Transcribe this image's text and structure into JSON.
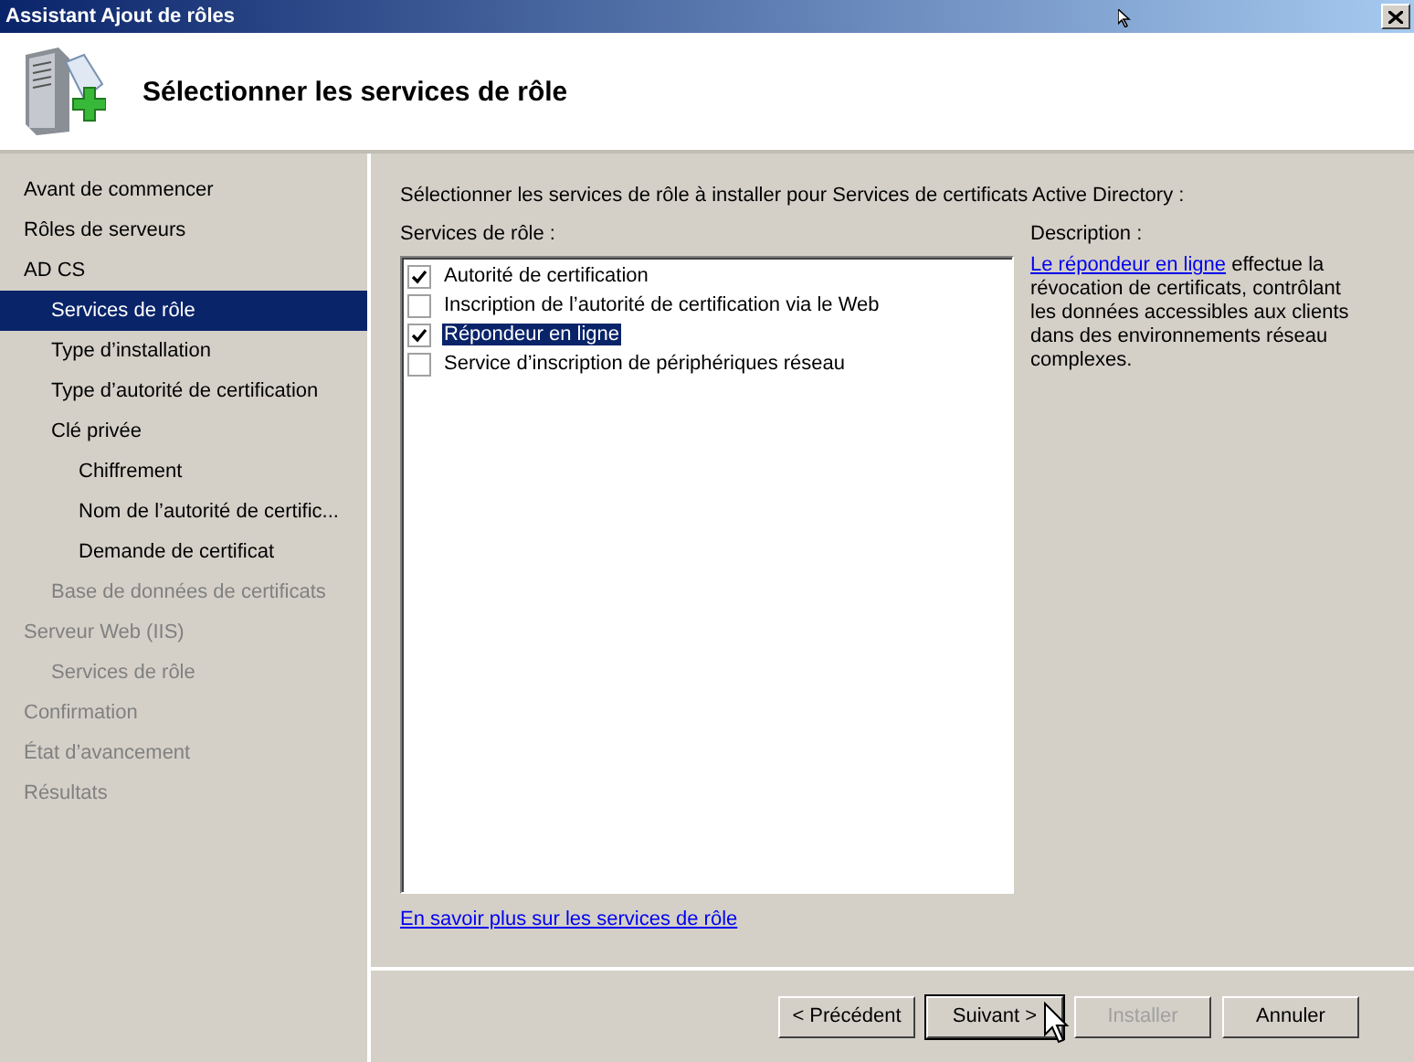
{
  "window": {
    "title": "Assistant Ajout de rôles"
  },
  "header": {
    "title": "Sélectionner les services de rôle"
  },
  "sidebar": {
    "items": [
      {
        "label": "Avant de commencer",
        "selected": false,
        "disabled": false
      },
      {
        "label": "Rôles de serveurs",
        "selected": false,
        "disabled": false
      },
      {
        "label": "AD CS",
        "selected": false,
        "disabled": false,
        "children": [
          {
            "label": "Services de rôle",
            "selected": true,
            "disabled": false
          },
          {
            "label": "Type d’installation",
            "selected": false,
            "disabled": false
          },
          {
            "label": "Type d’autorité de certification",
            "selected": false,
            "disabled": false
          },
          {
            "label": "Clé privée",
            "selected": false,
            "disabled": false,
            "children": [
              {
                "label": "Chiffrement",
                "selected": false,
                "disabled": false
              },
              {
                "label": "Nom de l’autorité de certific...",
                "selected": false,
                "disabled": false
              },
              {
                "label": "Demande de certificat",
                "selected": false,
                "disabled": false
              }
            ]
          },
          {
            "label": "Base de données de certificats",
            "selected": false,
            "disabled": true
          }
        ]
      },
      {
        "label": "Serveur Web (IIS)",
        "selected": false,
        "disabled": true,
        "children": [
          {
            "label": "Services de rôle",
            "selected": false,
            "disabled": true
          }
        ]
      },
      {
        "label": "Confirmation",
        "selected": false,
        "disabled": true
      },
      {
        "label": "État d’avancement",
        "selected": false,
        "disabled": true
      },
      {
        "label": "Résultats",
        "selected": false,
        "disabled": true
      }
    ]
  },
  "content": {
    "instruction": "Sélectionner les services de rôle à installer pour Services de certificats Active Directory :",
    "services_label": "Services de rôle :",
    "services": [
      {
        "label": "Autorité de certification",
        "checked": true,
        "selected": false
      },
      {
        "label": "Inscription de l’autorité de certification via le Web",
        "checked": false,
        "selected": false
      },
      {
        "label": "Répondeur en ligne",
        "checked": true,
        "selected": true
      },
      {
        "label": "Service d’inscription de périphériques réseau",
        "checked": false,
        "selected": false
      }
    ],
    "description_label": "Description :",
    "description": {
      "link": "Le répondeur en ligne",
      "text": "effectue la révocation de certificats, contrôlant les données accessibles aux clients dans des environnements réseau complexes."
    },
    "more_link": "En savoir plus sur les services de rôle"
  },
  "buttons": [
    {
      "label": "< Précédent",
      "disabled": false,
      "default": false
    },
    {
      "label": "Suivant >",
      "disabled": false,
      "default": true
    },
    {
      "label": "Installer",
      "disabled": true,
      "default": false
    },
    {
      "label": "Annuler",
      "disabled": false,
      "default": false
    }
  ]
}
